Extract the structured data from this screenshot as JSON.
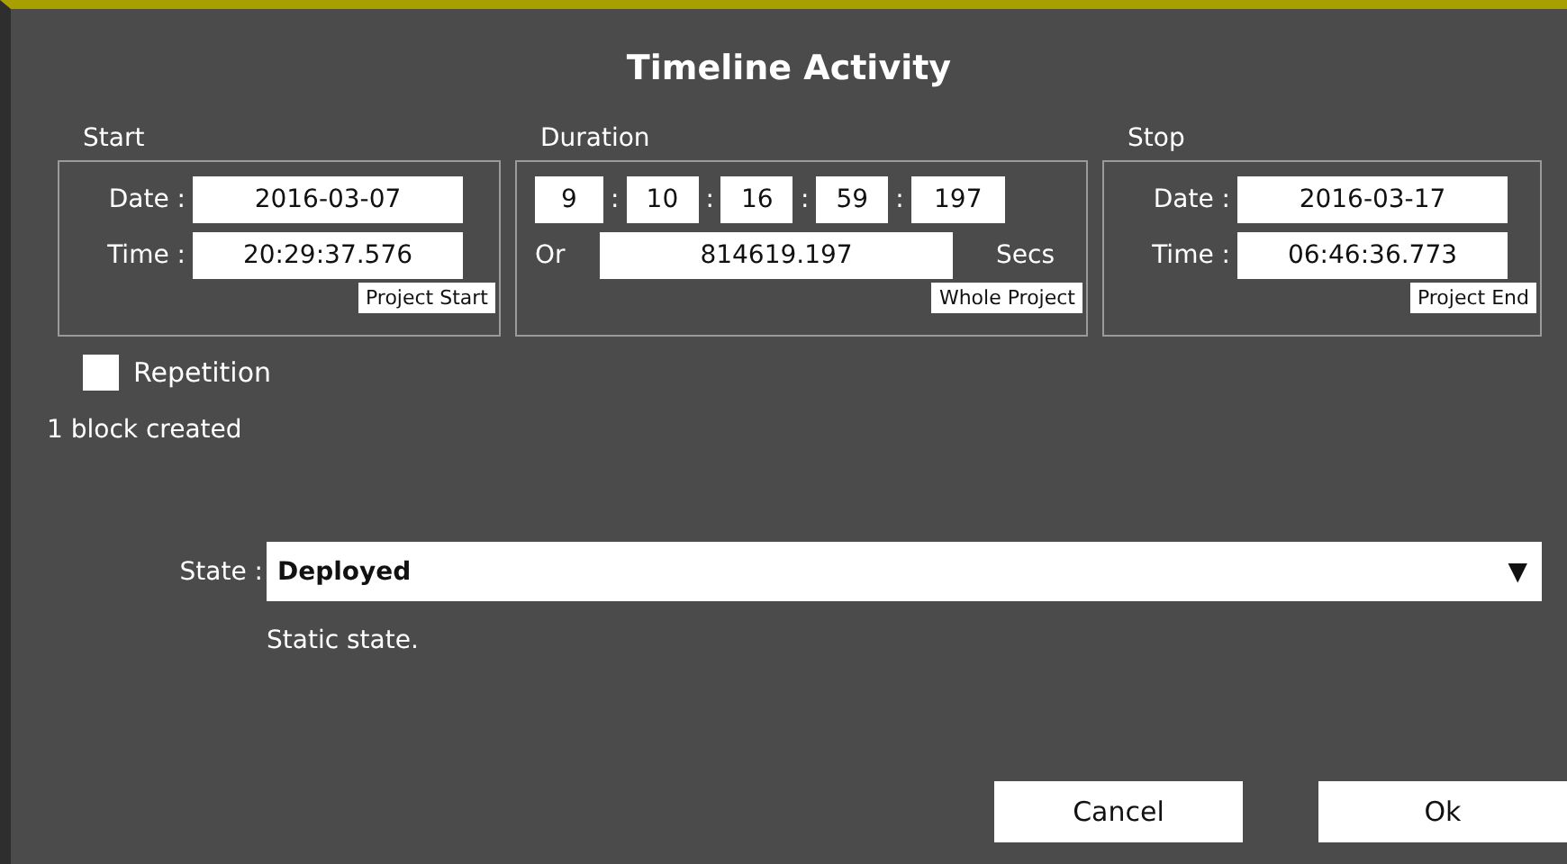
{
  "window": {
    "title": "Timeline Activity"
  },
  "start": {
    "label": "Start",
    "date_label": "Date :",
    "date": "2016-03-07",
    "time_label": "Time :",
    "time": "20:29:37.576",
    "button": "Project Start"
  },
  "duration": {
    "label": "Duration",
    "parts": [
      "9",
      "10",
      "16",
      "59",
      "197"
    ],
    "separator": ":",
    "or_label": "Or",
    "seconds": "814619.197",
    "unit": "Secs",
    "button": "Whole Project"
  },
  "stop": {
    "label": "Stop",
    "date_label": "Date :",
    "date": "2016-03-17",
    "time_label": "Time :",
    "time": "06:46:36.773",
    "button": "Project End"
  },
  "repetition": {
    "label": "Repetition",
    "checked": false
  },
  "status": "1 block created",
  "state": {
    "label": "State :",
    "value": "Deployed",
    "arrow": "▼",
    "description": "Static state."
  },
  "buttons": [
    "Cancel",
    "Ok"
  ]
}
